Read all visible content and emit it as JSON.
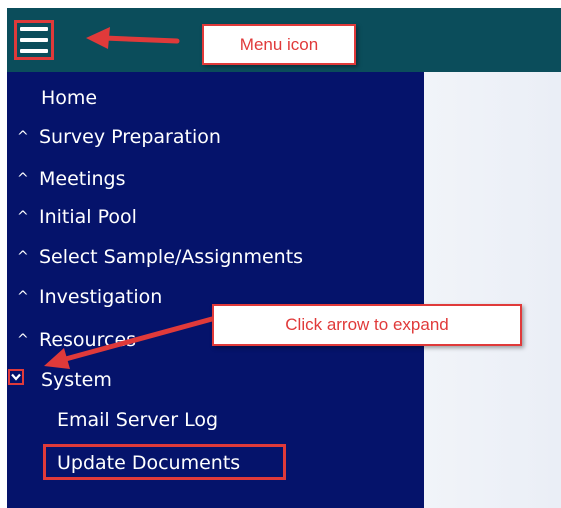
{
  "header": {
    "menu_icon": "hamburger-menu-icon",
    "bg_color": "#0b4d5b"
  },
  "sidebar": {
    "bg_color": "#05136b",
    "items": [
      {
        "label": "Home",
        "caret": ""
      },
      {
        "label": "Survey Preparation",
        "caret": "^"
      },
      {
        "label": "Meetings",
        "caret": "^"
      },
      {
        "label": "Initial Pool",
        "caret": "^"
      },
      {
        "label": "Select Sample/Assignments",
        "caret": "^"
      },
      {
        "label": "Investigation",
        "caret": "^"
      },
      {
        "label": "Resources",
        "caret": "^"
      },
      {
        "label": "System",
        "caret": "chevron-down",
        "expanded": true
      },
      {
        "label": "Email Server Log",
        "caret": ""
      },
      {
        "label": "Update Documents",
        "caret": ""
      }
    ]
  },
  "annotations": {
    "menu_callout": "Menu icon",
    "expand_callout": "Click arrow to expand",
    "accent_color": "#e03a3a"
  }
}
